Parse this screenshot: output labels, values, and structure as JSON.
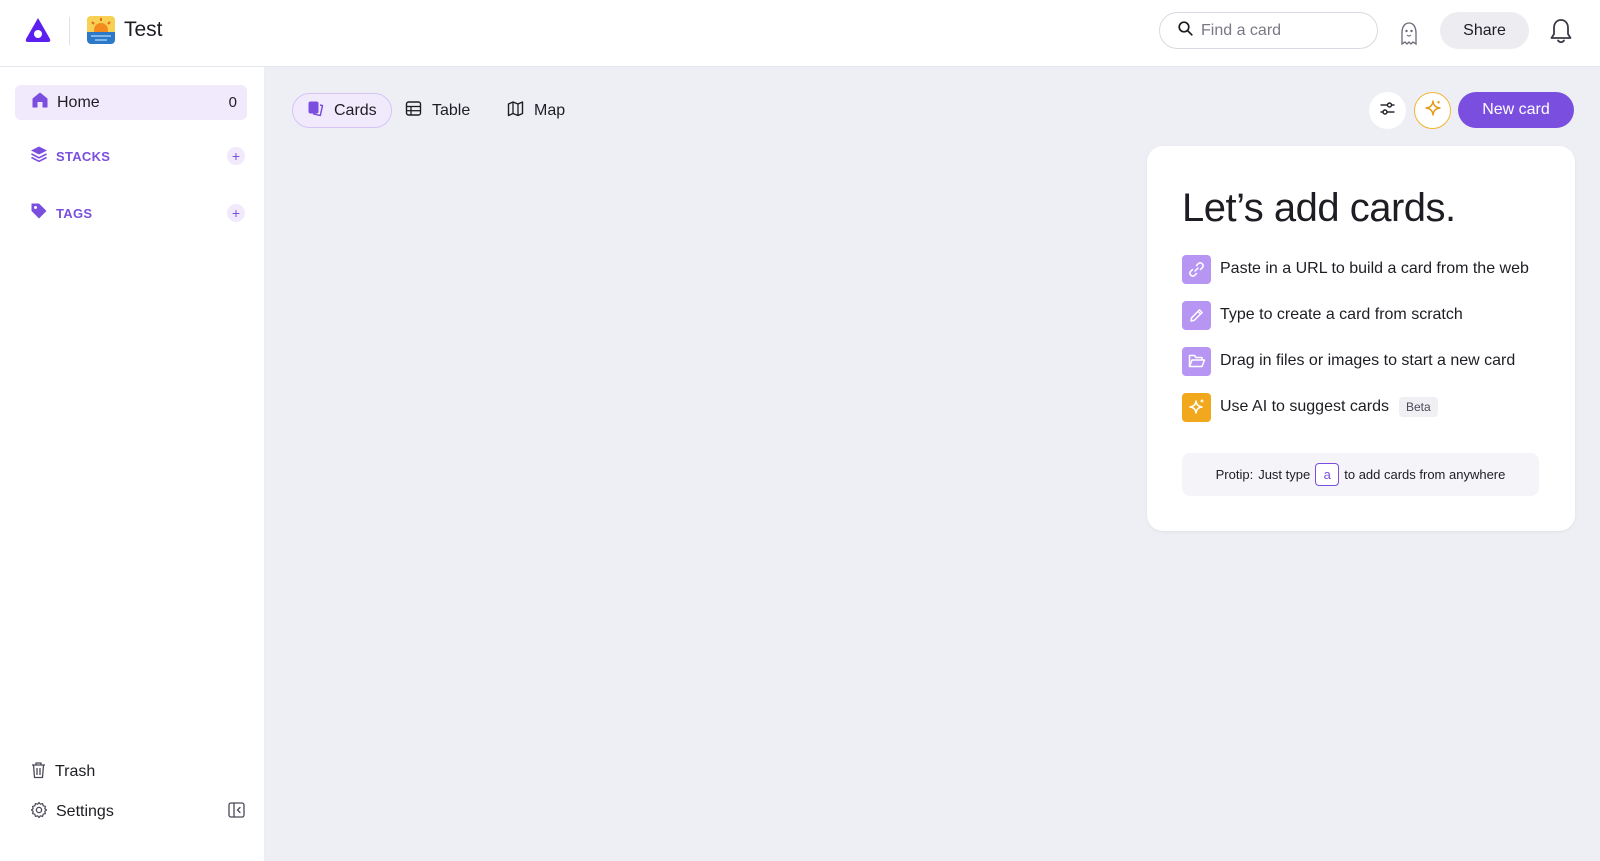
{
  "header": {
    "workspace_title": "Test",
    "search_placeholder": "Find a card",
    "share_label": "Share",
    "icons": [
      "logo-icon",
      "sunrise-emoji-icon",
      "search-icon",
      "avatar-icon",
      "bell-icon"
    ]
  },
  "sidebar": {
    "home": {
      "label": "Home",
      "count": "0"
    },
    "stacks_label": "STACKS",
    "tags_label": "TAGS",
    "trash_label": "Trash",
    "settings_label": "Settings"
  },
  "toolbar": {
    "tabs": [
      {
        "label": "Cards",
        "icon": "cards-icon",
        "active": true
      },
      {
        "label": "Table",
        "icon": "table-icon",
        "active": false
      },
      {
        "label": "Map",
        "icon": "map-icon",
        "active": false
      }
    ],
    "new_card_label": "New card"
  },
  "panel": {
    "title": "Let’s add cards.",
    "tips": [
      {
        "text": "Paste in a URL to build a card from the web",
        "icon": "link-icon"
      },
      {
        "text": "Type to create a card from scratch",
        "icon": "pencil-icon"
      },
      {
        "text": "Drag in files or images to start a new card",
        "icon": "folder-icon"
      },
      {
        "text": "Use AI to suggest cards",
        "icon": "sparkle-icon",
        "badge": "Beta"
      }
    ],
    "protip": {
      "label": "Protip:",
      "before": "Just type",
      "key": "a",
      "after": "to add cards from anywhere"
    }
  },
  "colors": {
    "accent": "#7a4fe0",
    "accent_light": "#f1eafc",
    "tip_icon_purple": "#b795f2",
    "ai_orange": "#f2a81d",
    "main_bg": "#edeff5"
  }
}
